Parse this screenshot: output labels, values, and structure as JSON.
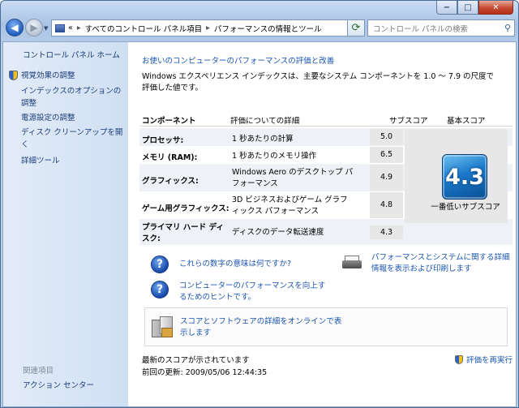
{
  "window": {
    "caption_min": "−",
    "caption_max": "□",
    "caption_close": "✕"
  },
  "nav": {
    "address_prefix": "«",
    "breadcrumb": [
      "すべてのコントロール パネル項目",
      "パフォーマンスの情報とツール"
    ],
    "separator": "▸",
    "search_placeholder": "コントロール パネルの検索"
  },
  "sidebar": {
    "home": "コントロール パネル ホーム",
    "items": [
      {
        "label": "視覚効果の調整",
        "shield": true
      },
      {
        "label": "インデックスのオプションの調整",
        "shield": false
      },
      {
        "label": "電源設定の調整",
        "shield": false
      },
      {
        "label": "ディスク クリーンアップを開く",
        "shield": false
      },
      {
        "label": "詳細ツール",
        "shield": false
      }
    ],
    "related_heading": "関連項目",
    "action_center": "アクション センター"
  },
  "main": {
    "title": "お使いのコンピューターのパフォーマンスの評価と改善",
    "description": "Windows エクスペリエンス インデックスは、主要なシステム コンポーネントを 1.0 ～ 7.9 の尺度で評価した値です。",
    "table": {
      "headers": {
        "component": "コンポーネント",
        "detail": "評価についての詳細",
        "subscore": "サブスコア",
        "basescore": "基本スコア"
      },
      "rows": [
        {
          "component": "プロセッサ:",
          "detail": "1 秒あたりの計算",
          "subscore": "5.0"
        },
        {
          "component": "メモリ (RAM):",
          "detail": "1 秒あたりのメモリ操作",
          "subscore": "6.5"
        },
        {
          "component": "グラフィックス:",
          "detail": "Windows Aero のデスクトップ パフォーマンス",
          "subscore": "4.9"
        },
        {
          "component": "ゲーム用グラフィックス:",
          "detail": "3D ビジネスおよびゲーム グラフィックス パフォーマンス",
          "subscore": "4.8"
        },
        {
          "component": "プライマリ ハード ディスク:",
          "detail": "ディスクのデータ転送速度",
          "subscore": "4.3"
        }
      ],
      "base_score": "4.3",
      "base_label": "一番低いサブスコア"
    },
    "help_1": "これらの数字の意味は何ですか?",
    "help_2": "コンピューターのパフォーマンスを向上するためのヒントです。",
    "print_link": "パフォーマンスとシステムに関する詳細情報を表示および印刷します",
    "online_link": "スコアとソフトウェアの詳細をオンラインで表示します",
    "latest": "最新のスコアが示されています",
    "updated": "前回の更新: 2009/05/06 12:44:35",
    "rerun": "評価を再実行"
  }
}
